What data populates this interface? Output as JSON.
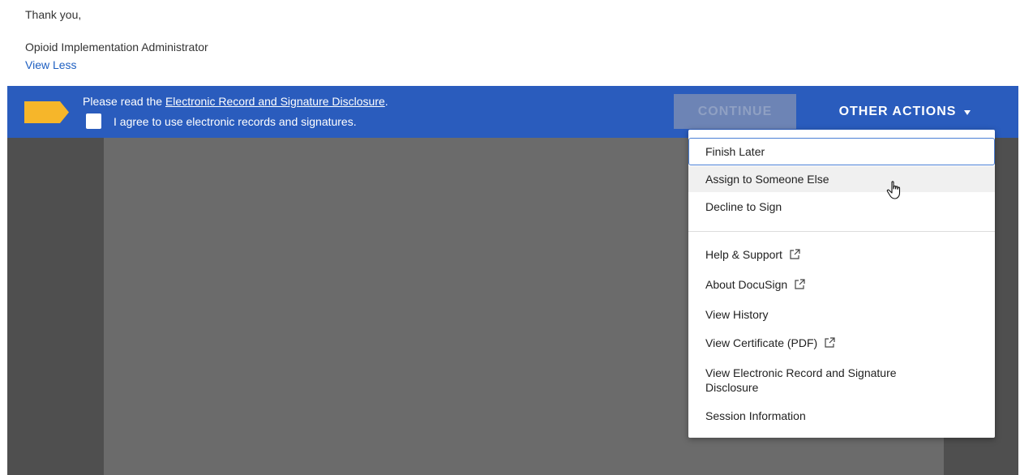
{
  "message": {
    "closing": "Thank you,",
    "sender": "Opioid Implementation Administrator",
    "view_less": "View Less"
  },
  "banner": {
    "read_prefix": "Please read the ",
    "disclosure_link": "Electronic Record and Signature Disclosure",
    "read_suffix": ".",
    "agree_label": "I agree to use electronic records and signatures.",
    "agree_checked": false,
    "continue_label": "CONTINUE",
    "other_actions_label": "OTHER ACTIONS",
    "colors": {
      "banner": "#2a5cbd",
      "tag": "#f6b62a"
    }
  },
  "menu": {
    "items": [
      {
        "label": "Finish Later",
        "external": false
      },
      {
        "label": "Assign to Someone Else",
        "external": false
      },
      {
        "label": "Decline to Sign",
        "external": false
      },
      {
        "label": "Help & Support",
        "external": true
      },
      {
        "label": "About DocuSign",
        "external": true
      },
      {
        "label": "View History",
        "external": false
      },
      {
        "label": "View Certificate (PDF)",
        "external": true
      },
      {
        "label": "View Electronic Record and Signature Disclosure",
        "external": false
      },
      {
        "label": "Session Information",
        "external": false
      }
    ],
    "focused_item": "Finish Later",
    "hovered_item": "Assign to Someone Else",
    "external_icon": "external-link-icon"
  }
}
